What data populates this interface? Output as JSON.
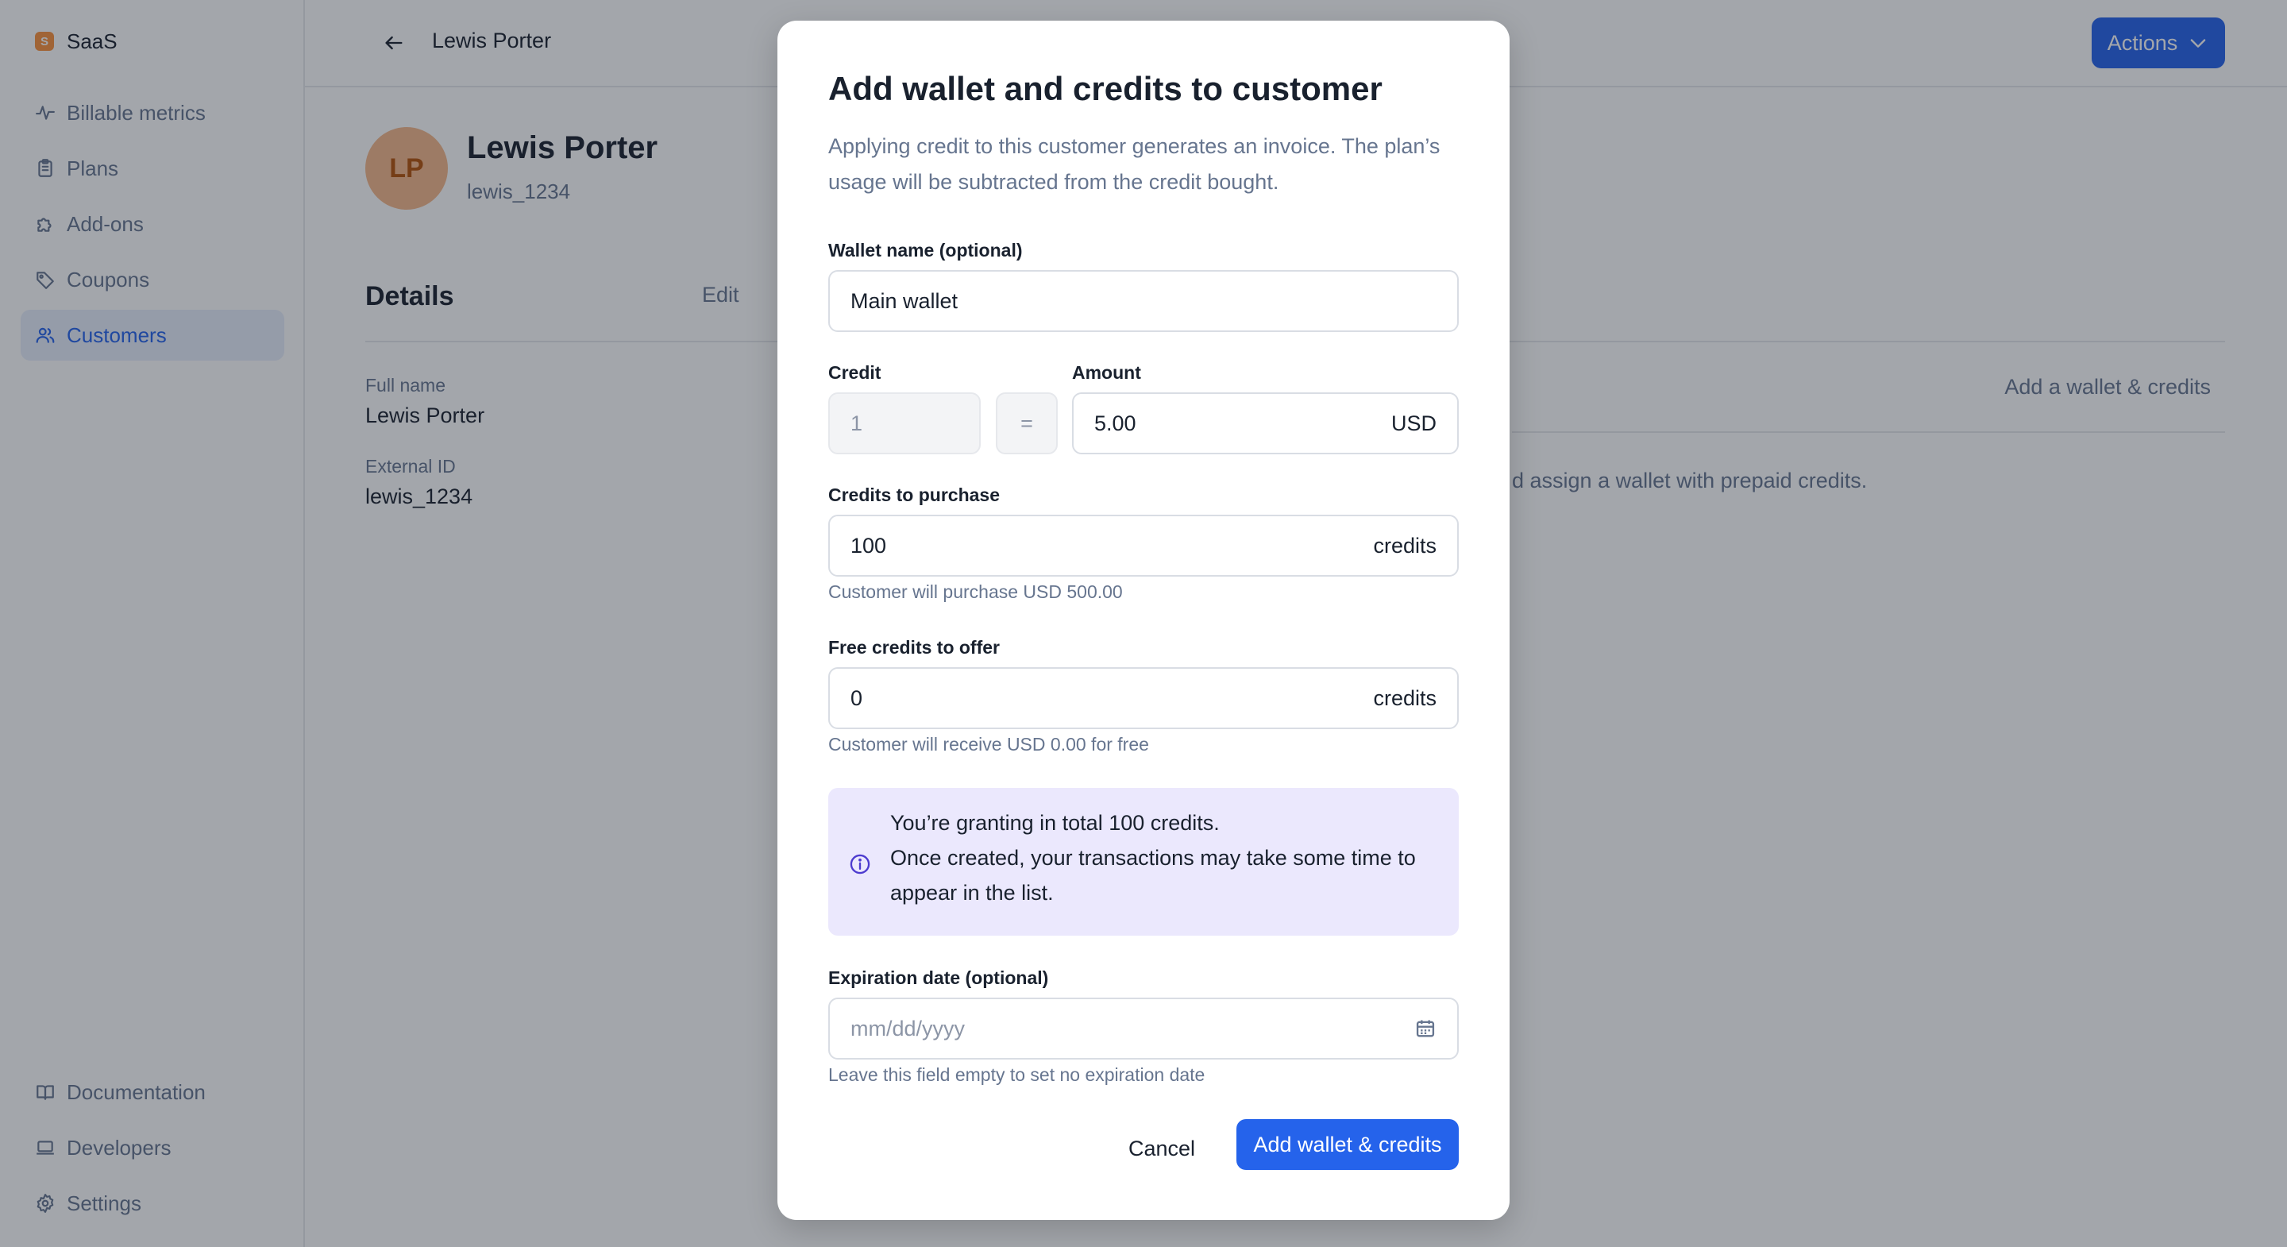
{
  "brand": {
    "logo_letter": "S",
    "name": "SaaS"
  },
  "sidebar": {
    "items": [
      {
        "label": "Billable metrics",
        "icon": "pulse-icon"
      },
      {
        "label": "Plans",
        "icon": "clipboard-icon"
      },
      {
        "label": "Add-ons",
        "icon": "puzzle-icon"
      },
      {
        "label": "Coupons",
        "icon": "tag-icon"
      },
      {
        "label": "Customers",
        "icon": "users-icon"
      }
    ],
    "bottom_items": [
      {
        "label": "Documentation",
        "icon": "book-icon"
      },
      {
        "label": "Developers",
        "icon": "laptop-icon"
      },
      {
        "label": "Settings",
        "icon": "gear-icon"
      }
    ]
  },
  "header": {
    "title": "Lewis Porter",
    "actions_label": "Actions"
  },
  "customer": {
    "initials": "LP",
    "name": "Lewis Porter",
    "external_id": "lewis_1234",
    "details_title": "Details",
    "edit_label": "Edit",
    "full_name_label": "Full name",
    "full_name_value": "Lewis Porter",
    "external_id_label": "External ID",
    "external_id_value": "lewis_1234"
  },
  "wallet_section": {
    "add_link": "Add a wallet & credits",
    "empty_text": "d assign a wallet with prepaid credits."
  },
  "dialog": {
    "title": "Add wallet and credits to customer",
    "description": "Applying credit to this customer generates an invoice. The plan’s usage will be subtracted from the credit bought.",
    "wallet_name_label": "Wallet name (optional)",
    "wallet_name_value": "Main wallet",
    "credit_label": "Credit",
    "credit_value": "1",
    "equals": "=",
    "amount_label": "Amount",
    "amount_value": "5.00",
    "amount_currency": "USD",
    "credits_purchase_label": "Credits to purchase",
    "credits_purchase_value": "100",
    "credits_unit": "credits",
    "credits_purchase_helper": "Customer will purchase USD 500.00",
    "free_credits_label": "Free credits to offer",
    "free_credits_value": "0",
    "free_credits_helper": "Customer will receive USD 0.00 for free",
    "info_line1": "You’re granting in total 100 credits.",
    "info_line2": "Once created, your transactions may take some time to appear in the list.",
    "expiration_label": "Expiration date (optional)",
    "expiration_placeholder": "mm/dd/yyyy",
    "expiration_helper": "Leave this field empty to set no expiration date",
    "cancel_label": "Cancel",
    "submit_label": "Add wallet & credits"
  },
  "colors": {
    "primary": "#2563eb",
    "info_bg": "#ebe8fd",
    "info_icon": "#4c3bcf",
    "avatar_bg": "#f5b88a"
  }
}
